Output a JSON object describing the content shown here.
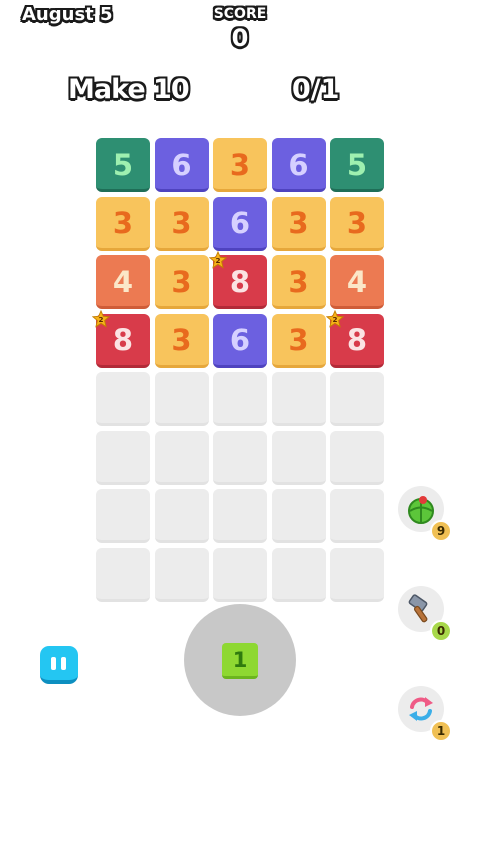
{
  "header": {
    "date": "August 5",
    "score_label": "SCORE",
    "score_value": "0"
  },
  "goal": {
    "label": "Make 10",
    "progress": "0/1"
  },
  "colors": {
    "5": "#2e8f72",
    "6": "#6c60e0",
    "3": "#f8c45c",
    "4": "#ec7a52",
    "8": "#d83b4a",
    "empty": "#ececec"
  },
  "board": {
    "columns": 5,
    "rows": 8,
    "tiles": [
      {
        "value": "5",
        "star": false
      },
      {
        "value": "6",
        "star": false
      },
      {
        "value": "3",
        "star": false
      },
      {
        "value": "6",
        "star": false
      },
      {
        "value": "5",
        "star": false
      },
      {
        "value": "3",
        "star": false
      },
      {
        "value": "3",
        "star": false
      },
      {
        "value": "6",
        "star": false
      },
      {
        "value": "3",
        "star": false
      },
      {
        "value": "3",
        "star": false
      },
      {
        "value": "4",
        "star": false
      },
      {
        "value": "3",
        "star": false
      },
      {
        "value": "8",
        "star": true,
        "star_label": "2"
      },
      {
        "value": "3",
        "star": false
      },
      {
        "value": "4",
        "star": false
      },
      {
        "value": "8",
        "star": true,
        "star_label": "2"
      },
      {
        "value": "3",
        "star": false
      },
      {
        "value": "6",
        "star": false
      },
      {
        "value": "3",
        "star": false
      },
      {
        "value": "8",
        "star": true,
        "star_label": "2"
      }
    ]
  },
  "next_tile": {
    "value": "1"
  },
  "powerups": [
    {
      "name": "shuffle-ball-icon",
      "count": "9"
    },
    {
      "name": "hammer-icon",
      "count": "0"
    },
    {
      "name": "swap-arrows-icon",
      "count": "1"
    }
  ]
}
